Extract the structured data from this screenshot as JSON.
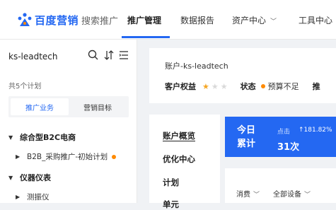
{
  "brand": {
    "name": "百度营销",
    "product": "搜索推广",
    "primary_color": "#2468f2"
  },
  "nav": {
    "items": [
      "推广管理",
      "数据报告",
      "资产中心",
      "工具中心"
    ],
    "active": "推广管理"
  },
  "sidebar": {
    "account": "ks-leadtech",
    "plan_count": "共5个计划",
    "tabs": [
      "推广业务",
      "营销目标"
    ],
    "active_tab": "推广业务",
    "tree": [
      {
        "label": "综合型B2C电商",
        "type": "group",
        "expanded": true
      },
      {
        "label": "B2B_采购推广-初始计划",
        "type": "plan",
        "status_dot": "orange"
      },
      {
        "label": "仪器仪表",
        "type": "group",
        "expanded": true
      },
      {
        "label": "测振仪",
        "type": "plan"
      }
    ]
  },
  "account_header": {
    "account_label": "账户-ks-leadtech",
    "rights_label": "客户权益",
    "rights_stars": 1,
    "rights_stars_max": 3,
    "status_label": "状态",
    "status_value": "预算不足",
    "next_label": "推"
  },
  "left_menu": {
    "items": [
      "账户概览",
      "优化中心",
      "计划",
      "单元"
    ],
    "active": "账户概览"
  },
  "today_card": {
    "title_line1": "今日",
    "title_line2": "累计",
    "click_label": "点击",
    "rate": "↑181.82%",
    "count": "31次"
  },
  "filters": {
    "metric": "消费",
    "device": "全部设备"
  }
}
